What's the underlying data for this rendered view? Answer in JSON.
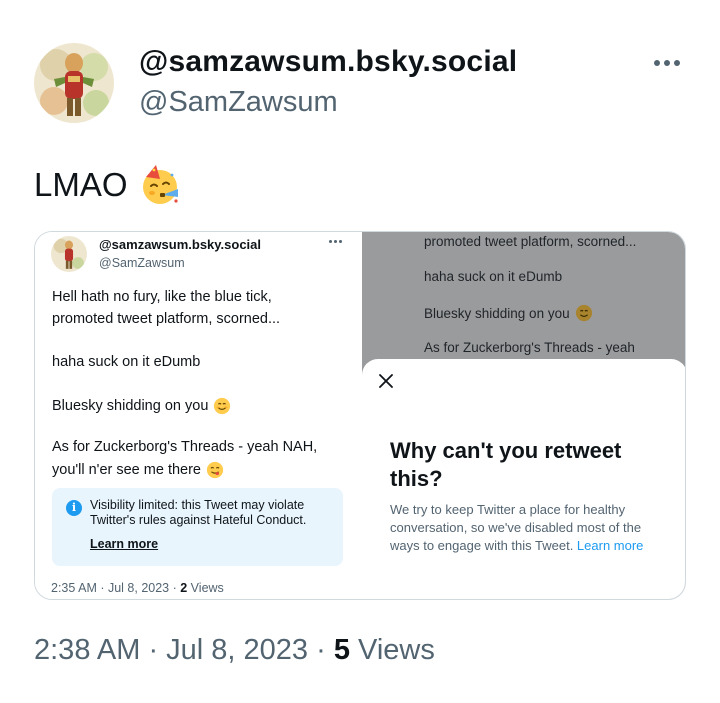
{
  "author": {
    "display_name": "@samzawsum.bsky.social",
    "handle": "@SamZawsum",
    "avatar_icon": "painted-figure-avatar-icon",
    "more_icon": "more-options-icon"
  },
  "tweet": {
    "text": "LMAO",
    "emoji": "partying-face-emoji"
  },
  "quoted_screenshot": {
    "author_name": "@samzawsum.bsky.social",
    "author_handle": "@SamZawsum",
    "lines": [
      "Hell hath no fury, like the blue tick,",
      "promoted tweet platform, scorned...",
      "haha suck on it eDumb",
      "Bluesky shidding on you",
      "As for Zuckerborg's Threads - yeah NAH,",
      "you'll n'er see me there"
    ],
    "notice_text": "Visibility limited: this Tweet may violate Twitter's rules against Hateful Conduct.",
    "notice_link": "Learn more",
    "time": "2:35 AM · Jul 8, 2023 · ",
    "views_count": "2",
    "views_label": " Views",
    "dim_lines": [
      "promoted tweet platform, scorned...",
      "haha suck on it eDumb",
      "Bluesky shidding on you",
      "As for Zuckerborg's Threads - yeah"
    ],
    "sheet_title": "Why can't you retweet this?",
    "sheet_body": "We try to keep Twitter a place for healthy conversation, so we've disabled most of the ways to engage with this Tweet. ",
    "sheet_link": "Learn more"
  },
  "footer": {
    "time": "2:38 AM · Jul 8, 2023 · ",
    "views_count": "5",
    "views_label": " Views"
  },
  "colors": {
    "text": "#0f1419",
    "secondary": "#536471",
    "accent": "#1d9bf0",
    "notice_bg": "#e8f5fd",
    "dim_overlay": "#9a9b9d"
  }
}
